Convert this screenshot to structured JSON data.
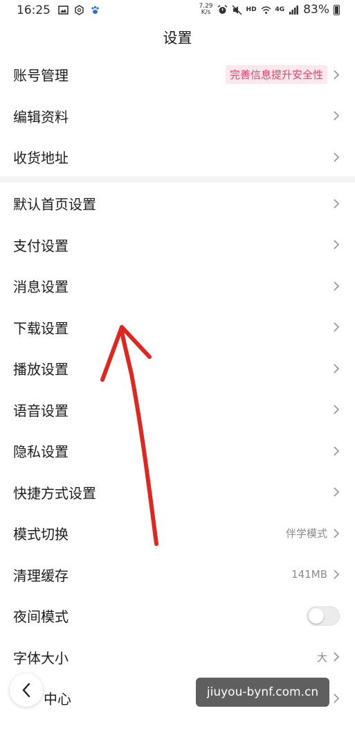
{
  "status_bar": {
    "time": "16:25",
    "net_speed_value": "7.29",
    "net_speed_unit": "K/s",
    "hd": "HD",
    "signal": "4G",
    "battery": "83%"
  },
  "header": {
    "title": "设置"
  },
  "group1": [
    {
      "label": "账号管理",
      "badge": "完善信息提升安全性"
    },
    {
      "label": "编辑资料"
    },
    {
      "label": "收货地址"
    }
  ],
  "group2": [
    {
      "label": "默认首页设置"
    },
    {
      "label": "支付设置"
    },
    {
      "label": "消息设置"
    },
    {
      "label": "下载设置"
    },
    {
      "label": "播放设置"
    },
    {
      "label": "语音设置"
    },
    {
      "label": "隐私设置"
    },
    {
      "label": "快捷方式设置"
    },
    {
      "label": "模式切换",
      "value": "伴学模式"
    },
    {
      "label": "清理缓存",
      "value": "141MB"
    },
    {
      "label": "夜间模式",
      "toggle": false
    },
    {
      "label": "字体大小",
      "value": "大"
    },
    {
      "label": "中心"
    }
  ],
  "watermark": "jiuyou-bynf.com.cn",
  "colors": {
    "badge_text": "#e5426b",
    "badge_bg": "#fde8ee",
    "annotation_arrow": "#e0261f"
  }
}
